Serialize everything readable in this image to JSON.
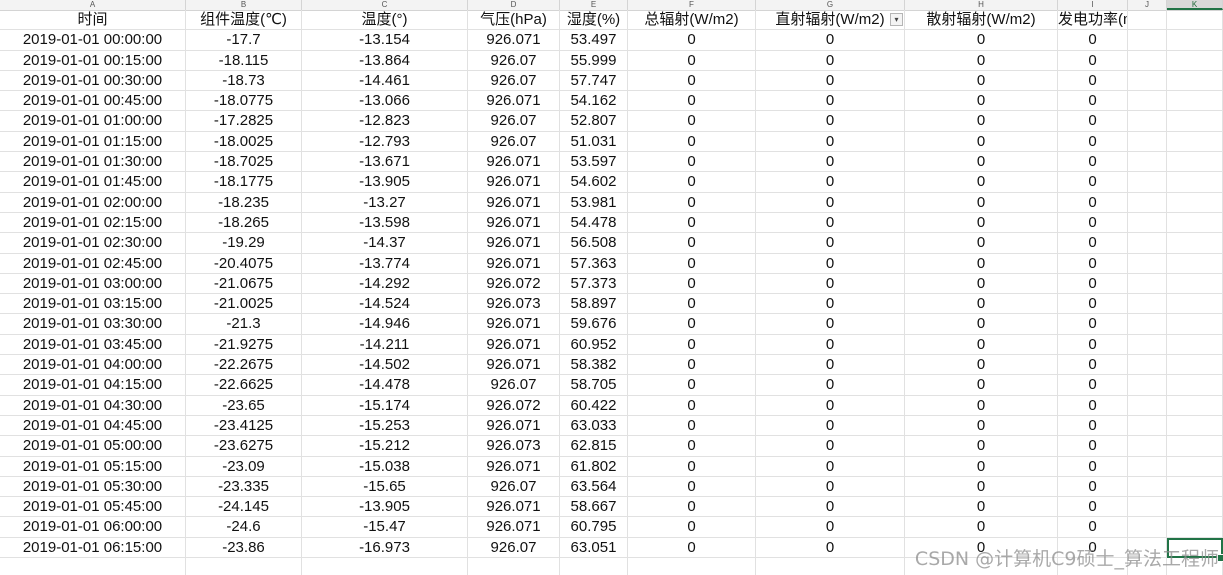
{
  "column_letters": [
    "A",
    "B",
    "C",
    "D",
    "E",
    "F",
    "G",
    "H",
    "I",
    "J",
    "K"
  ],
  "selected_column": "K",
  "headers": [
    "时间",
    "组件温度(℃)",
    "温度(°)",
    "气压(hPa)",
    "湿度(%)",
    "总辐射(W/m2)",
    "直射辐射(W/m2)",
    "散射辐射(W/m2)",
    "发电功率(mw)"
  ],
  "filter_icon": "chevron-down-icon",
  "rows": [
    [
      "2019-01-01 00:00:00",
      "-17.7",
      "-13.154",
      "926.071",
      "53.497",
      "0",
      "0",
      "0",
      "0"
    ],
    [
      "2019-01-01 00:15:00",
      "-18.115",
      "-13.864",
      "926.07",
      "55.999",
      "0",
      "0",
      "0",
      "0"
    ],
    [
      "2019-01-01 00:30:00",
      "-18.73",
      "-14.461",
      "926.07",
      "57.747",
      "0",
      "0",
      "0",
      "0"
    ],
    [
      "2019-01-01 00:45:00",
      "-18.0775",
      "-13.066",
      "926.071",
      "54.162",
      "0",
      "0",
      "0",
      "0"
    ],
    [
      "2019-01-01 01:00:00",
      "-17.2825",
      "-12.823",
      "926.07",
      "52.807",
      "0",
      "0",
      "0",
      "0"
    ],
    [
      "2019-01-01 01:15:00",
      "-18.0025",
      "-12.793",
      "926.07",
      "51.031",
      "0",
      "0",
      "0",
      "0"
    ],
    [
      "2019-01-01 01:30:00",
      "-18.7025",
      "-13.671",
      "926.071",
      "53.597",
      "0",
      "0",
      "0",
      "0"
    ],
    [
      "2019-01-01 01:45:00",
      "-18.1775",
      "-13.905",
      "926.071",
      "54.602",
      "0",
      "0",
      "0",
      "0"
    ],
    [
      "2019-01-01 02:00:00",
      "-18.235",
      "-13.27",
      "926.071",
      "53.981",
      "0",
      "0",
      "0",
      "0"
    ],
    [
      "2019-01-01 02:15:00",
      "-18.265",
      "-13.598",
      "926.071",
      "54.478",
      "0",
      "0",
      "0",
      "0"
    ],
    [
      "2019-01-01 02:30:00",
      "-19.29",
      "-14.37",
      "926.071",
      "56.508",
      "0",
      "0",
      "0",
      "0"
    ],
    [
      "2019-01-01 02:45:00",
      "-20.4075",
      "-13.774",
      "926.071",
      "57.363",
      "0",
      "0",
      "0",
      "0"
    ],
    [
      "2019-01-01 03:00:00",
      "-21.0675",
      "-14.292",
      "926.072",
      "57.373",
      "0",
      "0",
      "0",
      "0"
    ],
    [
      "2019-01-01 03:15:00",
      "-21.0025",
      "-14.524",
      "926.073",
      "58.897",
      "0",
      "0",
      "0",
      "0"
    ],
    [
      "2019-01-01 03:30:00",
      "-21.3",
      "-14.946",
      "926.071",
      "59.676",
      "0",
      "0",
      "0",
      "0"
    ],
    [
      "2019-01-01 03:45:00",
      "-21.9275",
      "-14.211",
      "926.071",
      "60.952",
      "0",
      "0",
      "0",
      "0"
    ],
    [
      "2019-01-01 04:00:00",
      "-22.2675",
      "-14.502",
      "926.071",
      "58.382",
      "0",
      "0",
      "0",
      "0"
    ],
    [
      "2019-01-01 04:15:00",
      "-22.6625",
      "-14.478",
      "926.07",
      "58.705",
      "0",
      "0",
      "0",
      "0"
    ],
    [
      "2019-01-01 04:30:00",
      "-23.65",
      "-15.174",
      "926.072",
      "60.422",
      "0",
      "0",
      "0",
      "0"
    ],
    [
      "2019-01-01 04:45:00",
      "-23.4125",
      "-15.253",
      "926.071",
      "63.033",
      "0",
      "0",
      "0",
      "0"
    ],
    [
      "2019-01-01 05:00:00",
      "-23.6275",
      "-15.212",
      "926.073",
      "62.815",
      "0",
      "0",
      "0",
      "0"
    ],
    [
      "2019-01-01 05:15:00",
      "-23.09",
      "-15.038",
      "926.071",
      "61.802",
      "0",
      "0",
      "0",
      "0"
    ],
    [
      "2019-01-01 05:30:00",
      "-23.335",
      "-15.65",
      "926.07",
      "63.564",
      "0",
      "0",
      "0",
      "0"
    ],
    [
      "2019-01-01 05:45:00",
      "-24.145",
      "-13.905",
      "926.071",
      "58.667",
      "0",
      "0",
      "0",
      "0"
    ],
    [
      "2019-01-01 06:00:00",
      "-24.6",
      "-15.47",
      "926.071",
      "60.795",
      "0",
      "0",
      "0",
      "0"
    ],
    [
      "2019-01-01 06:15:00",
      "-23.86",
      "-16.973",
      "926.07",
      "63.051",
      "0",
      "0",
      "0",
      "0"
    ]
  ],
  "watermark": "CSDN @计算机C9硕士_算法工程师",
  "colors": {
    "accent": "#217346",
    "gridline": "#e1e1e1",
    "header_bg": "#f3f3f3"
  }
}
